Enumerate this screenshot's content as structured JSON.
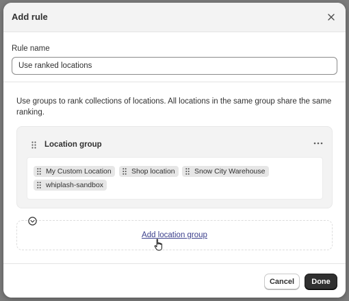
{
  "modal": {
    "title": "Add rule",
    "close_icon": "close-icon"
  },
  "rule_name": {
    "label": "Rule name",
    "value": "Use ranked locations"
  },
  "description": "Use groups to rank collections of locations. All locations in the same group share the same ranking.",
  "location_group": {
    "title": "Location group",
    "more_icon": "more-horizontal-icon",
    "locations": [
      {
        "label": "My Custom Location"
      },
      {
        "label": "Shop location"
      },
      {
        "label": "Snow City Warehouse"
      },
      {
        "label": "whiplash-sandbox"
      }
    ]
  },
  "add_group": {
    "label": "Add location group"
  },
  "footer": {
    "cancel_label": "Cancel",
    "done_label": "Done"
  },
  "colors": {
    "primary_button": "#303030",
    "link": "#3b3f8c",
    "tag_bg": "#e6e6e6"
  }
}
